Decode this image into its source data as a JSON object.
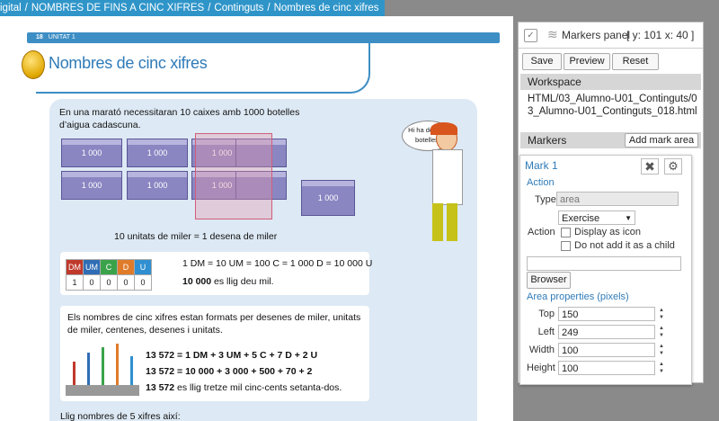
{
  "breadcrumb": {
    "items": [
      "igital",
      "NOMBRES DE FINS A CINC XIFRES",
      "Continguts",
      "Nombres de cinc xifres"
    ],
    "separator": "/"
  },
  "book": {
    "page_number": "18",
    "unit": "UNITAT 1",
    "title": "Nombres de cinc xifres",
    "intro": "En una marató necessitaran 10 caixes amb 1000 botelles d’aigua cadascuna.",
    "box_label": "1 000",
    "speech": "Hi ha deu mil botelles.",
    "caption": "10 unitats de miler = 1 desena de miler",
    "place_headers": [
      "DM",
      "UM",
      "C",
      "D",
      "U"
    ],
    "place_values": [
      "1",
      "0",
      "0",
      "0",
      "0"
    ],
    "eq1": "1 DM = 10 UM = 100 C = 1 000 D = 10 000 U",
    "read1_num": "10 000",
    "read1_txt": "es llig deu mil.",
    "bullet": "Els nombres de cinc xifres estan formats per desenes de miler, unitats de miler, centenes, desenes i unitats.",
    "eq2": "13 572 = 1 DM + 3 UM + 5 C + 7 D + 2 U",
    "eq3": "13 572 = 10 000 + 3 000 + 500 + 70 + 2",
    "read2_num": "13 572",
    "read2_txt": "es llig tretze mil cinc-cents setanta-dos.",
    "bottom": "Llig nombres de 5 xifres així:",
    "colors": {
      "DM": "#c0392b",
      "UM": "#2f6db5",
      "C": "#3aa34a",
      "D": "#d8342c",
      "U": "#2f8fd0"
    }
  },
  "panel": {
    "title": "Markers panel",
    "coords": "[ y: 101 x: 40 ]",
    "save": "Save",
    "preview": "Preview",
    "reset": "Reset",
    "workspace_label": "Workspace",
    "workspace_path": "HTML/03_Alumno-U01_Continguts/03_Alumno-U01_Continguts_018.html",
    "markers_label": "Markers",
    "add_mark": "Add mark area"
  },
  "mark": {
    "name": "Mark 1",
    "action_section": "Action",
    "type_label": "Type",
    "type_value": "area",
    "action_select": "Exercise",
    "action_label": "Action",
    "display_icon": "Display as icon",
    "no_child": "Do not add it as a child",
    "browse_value": "",
    "browser_btn": "Browser",
    "area_props": "Area properties (pixels)",
    "top_label": "Top",
    "top": "150",
    "left_label": "Left",
    "left": "249",
    "width_label": "Width",
    "width": "100",
    "height_label": "Height",
    "height": "100"
  }
}
